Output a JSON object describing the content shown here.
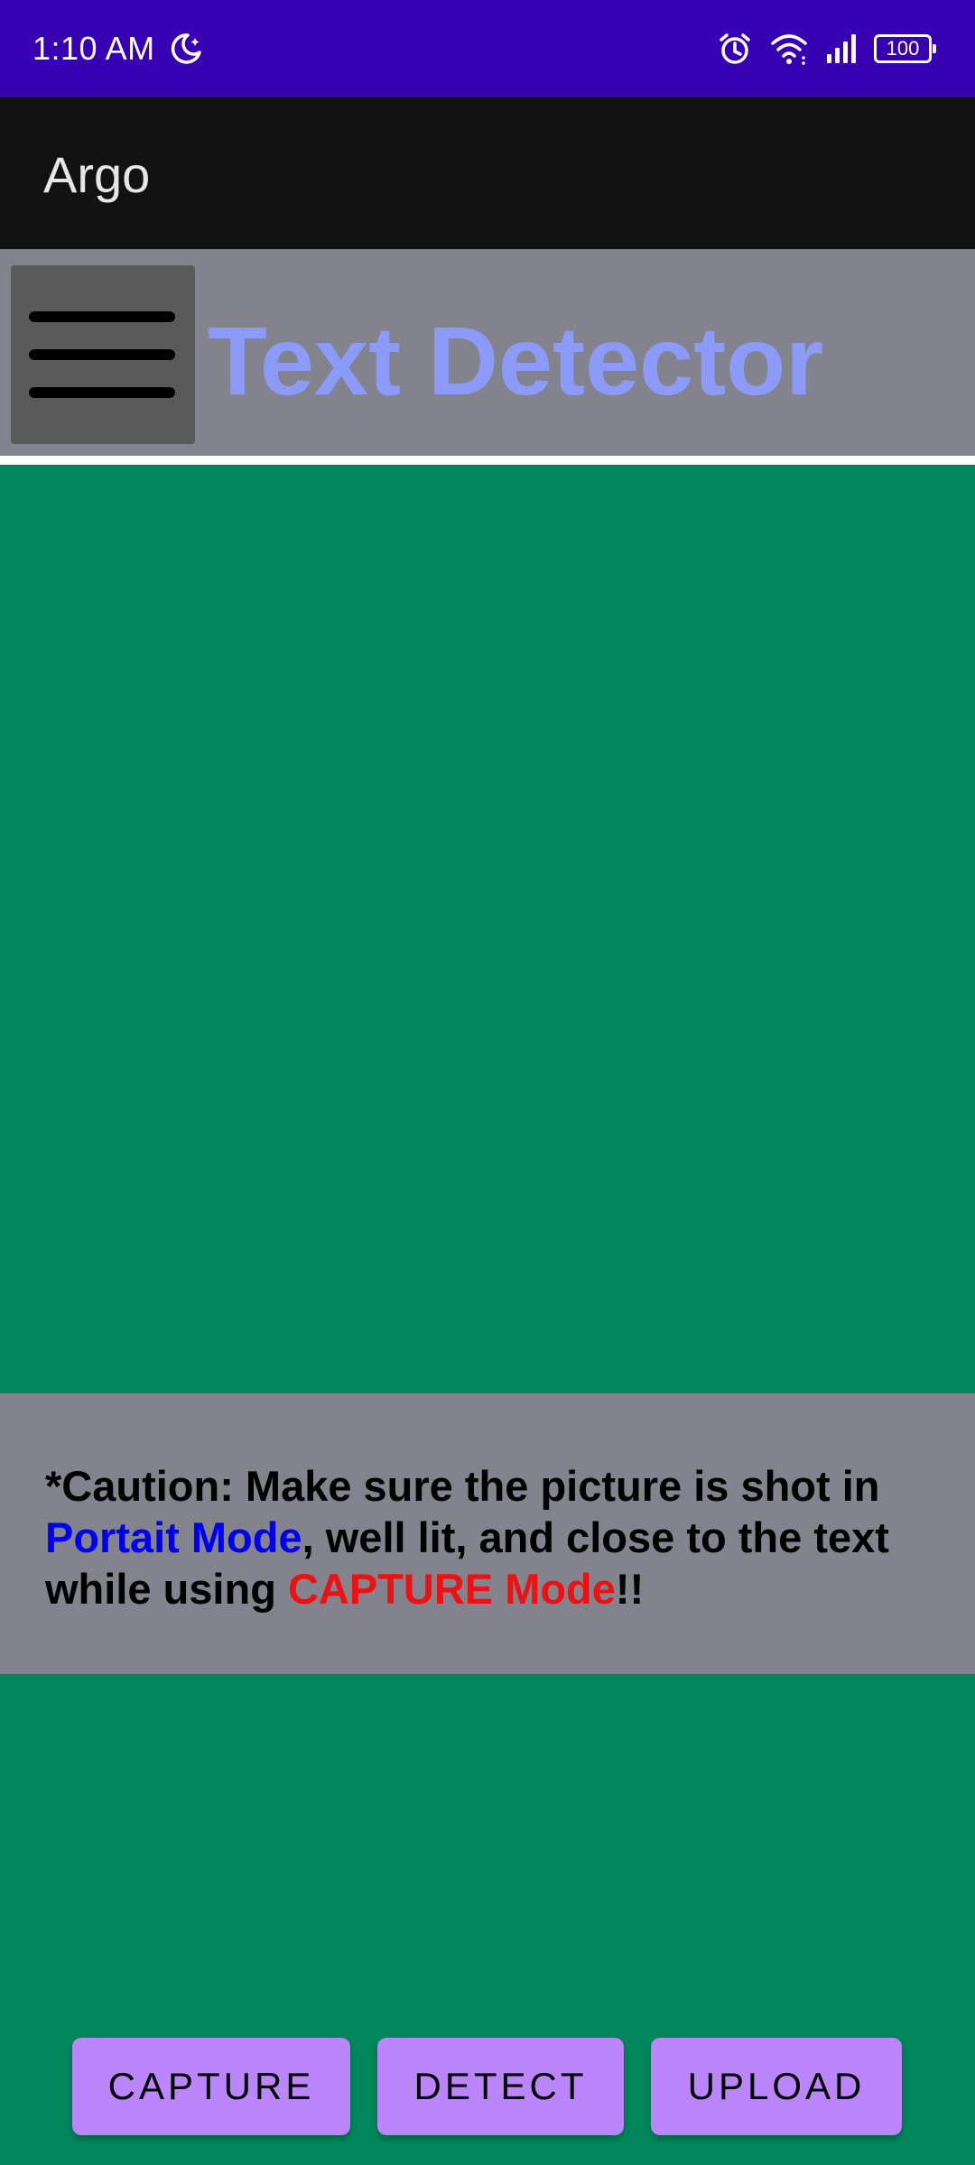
{
  "status_bar": {
    "time": "1:10 AM",
    "icons": [
      "moon-icon",
      "alarm-icon",
      "wifi-icon",
      "signal-icon",
      "battery-icon"
    ],
    "battery_level": "100",
    "background": "#3700b3"
  },
  "app_bar": {
    "title": "Argo",
    "background": "#121212"
  },
  "header": {
    "menu_icon": "hamburger-icon",
    "title": "Text Detector",
    "title_color": "#8c9bfa",
    "background": "#83838e"
  },
  "caution": {
    "part1": "*Caution: Make sure the picture is shot in ",
    "highlight1": "Portait Mode",
    "part2": ", well lit, and close to the text while using ",
    "highlight2": "CAPTURE Mode",
    "part3": "!!",
    "highlight1_color": "#0000ee",
    "highlight2_color": "#ee1111"
  },
  "actions": {
    "capture": "CAPTURE",
    "detect": "DETECT",
    "upload": "UPLOAD",
    "button_color": "#bb86fc"
  },
  "content_background": "#01855b"
}
